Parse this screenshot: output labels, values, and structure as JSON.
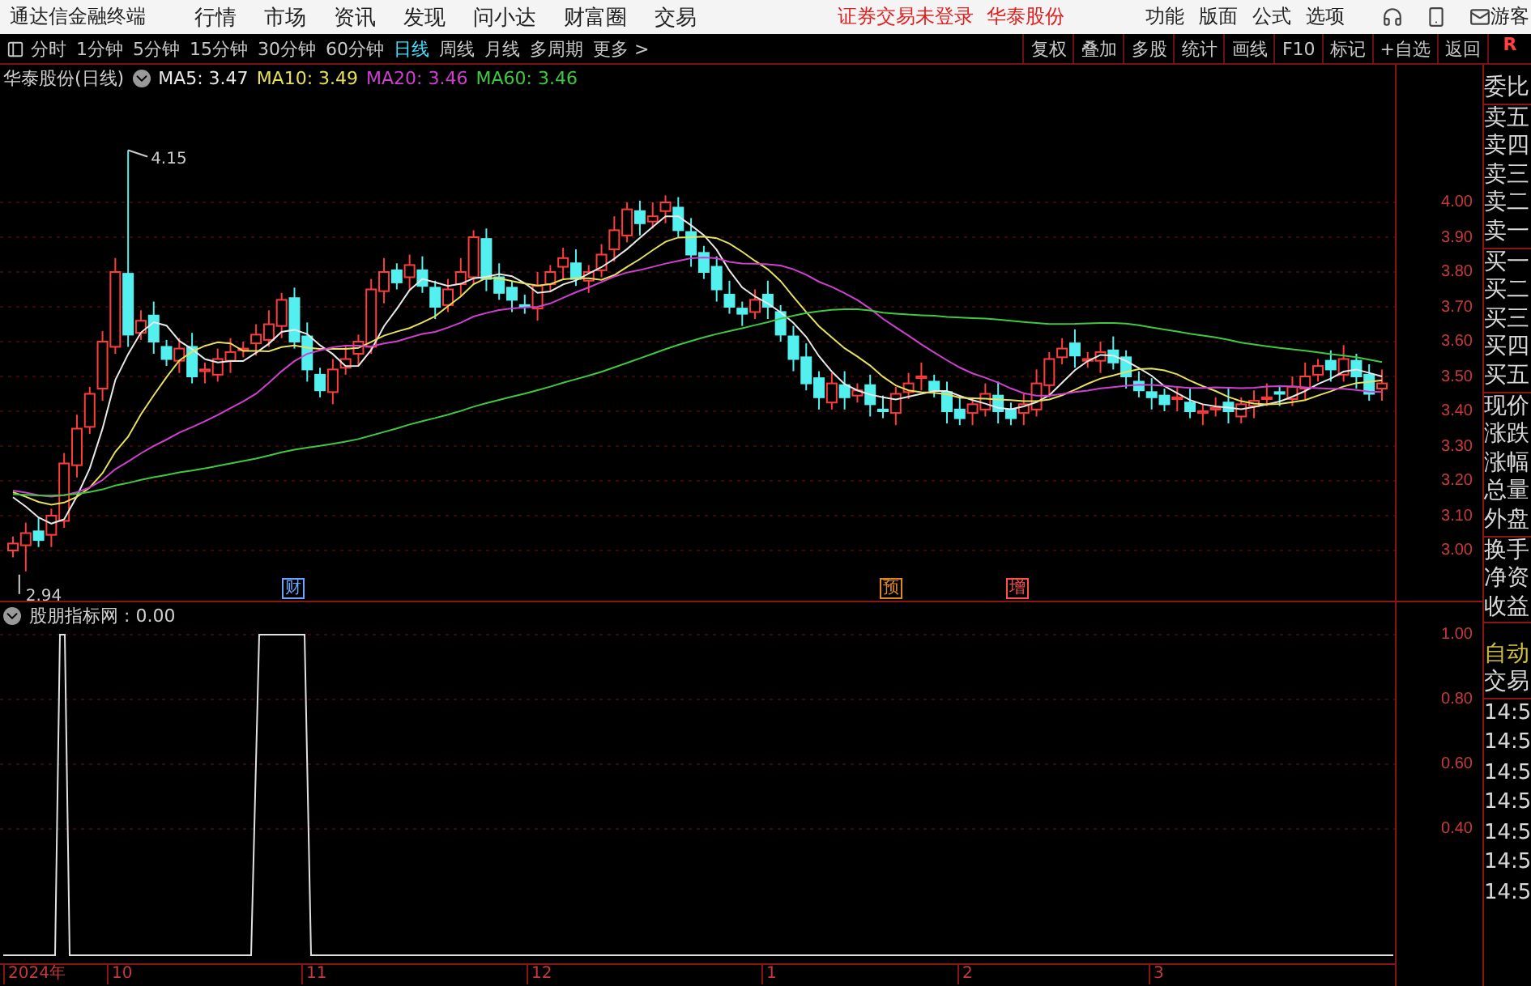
{
  "title_bar": {
    "app_name": "通达信金融终端",
    "menu": [
      "行情",
      "市场",
      "资讯",
      "发现",
      "问小达",
      "财富圈",
      "交易"
    ],
    "status": "证券交易未登录",
    "stock": "华泰股份",
    "tools": [
      "功能",
      "版面",
      "公式",
      "选项"
    ],
    "user": "游客"
  },
  "toolbar": {
    "periods": [
      {
        "label": "分时",
        "selected": false
      },
      {
        "label": "1分钟",
        "selected": false
      },
      {
        "label": "5分钟",
        "selected": false
      },
      {
        "label": "15分钟",
        "selected": false
      },
      {
        "label": "30分钟",
        "selected": false
      },
      {
        "label": "60分钟",
        "selected": false
      },
      {
        "label": "日线",
        "selected": true
      },
      {
        "label": "周线",
        "selected": false
      },
      {
        "label": "月线",
        "selected": false
      },
      {
        "label": "多周期",
        "selected": false
      },
      {
        "label": "更多 >",
        "selected": false
      }
    ],
    "actions": [
      "复权",
      "叠加",
      "多股",
      "统计",
      "画线",
      "F10",
      "标记",
      "+自选",
      "返回"
    ],
    "badge": "R"
  },
  "chart": {
    "title": "华泰股份(日线)",
    "ma": [
      {
        "label": "MA5: 3.47",
        "color": "#e8e8e8"
      },
      {
        "label": "MA10: 3.49",
        "color": "#e6e05a"
      },
      {
        "label": "MA20: 3.46",
        "color": "#d040d0"
      },
      {
        "label": "MA60: 3.46",
        "color": "#40c840"
      }
    ],
    "high_label": "4.15",
    "low_label": "2.94",
    "price_ticks": [
      "4.00",
      "3.90",
      "3.80",
      "3.70",
      "3.60",
      "3.50",
      "3.40",
      "3.30",
      "3.20",
      "3.10",
      "3.00"
    ],
    "events": [
      {
        "label": "财",
        "color": "#6aa8ff"
      },
      {
        "label": "预",
        "color": "#e08a20"
      },
      {
        "label": "增",
        "color": "#ff5050"
      }
    ]
  },
  "indicator": {
    "title": "股朋指标网 : 0.00",
    "ticks": [
      "1.00",
      "0.80",
      "0.60",
      "0.40"
    ]
  },
  "date_axis": [
    "2024年",
    "10",
    "11",
    "12",
    "1",
    "2",
    "3"
  ],
  "quote_panel": {
    "groups": [
      [
        "委比"
      ],
      [
        "卖五",
        "卖四",
        "卖三",
        "卖二",
        "卖一"
      ],
      [
        "买一",
        "买二",
        "买三",
        "买四",
        "买五"
      ],
      [
        "现价",
        "涨跌",
        "涨幅",
        "总量",
        "外盘"
      ],
      [
        "换手",
        "净资",
        "收益"
      ]
    ],
    "mode": "自动",
    "trade_header": "交易",
    "times": [
      "14:5",
      "14:5",
      "14:5",
      "14:5",
      "14:5",
      "14:5",
      "14:5"
    ]
  }
}
